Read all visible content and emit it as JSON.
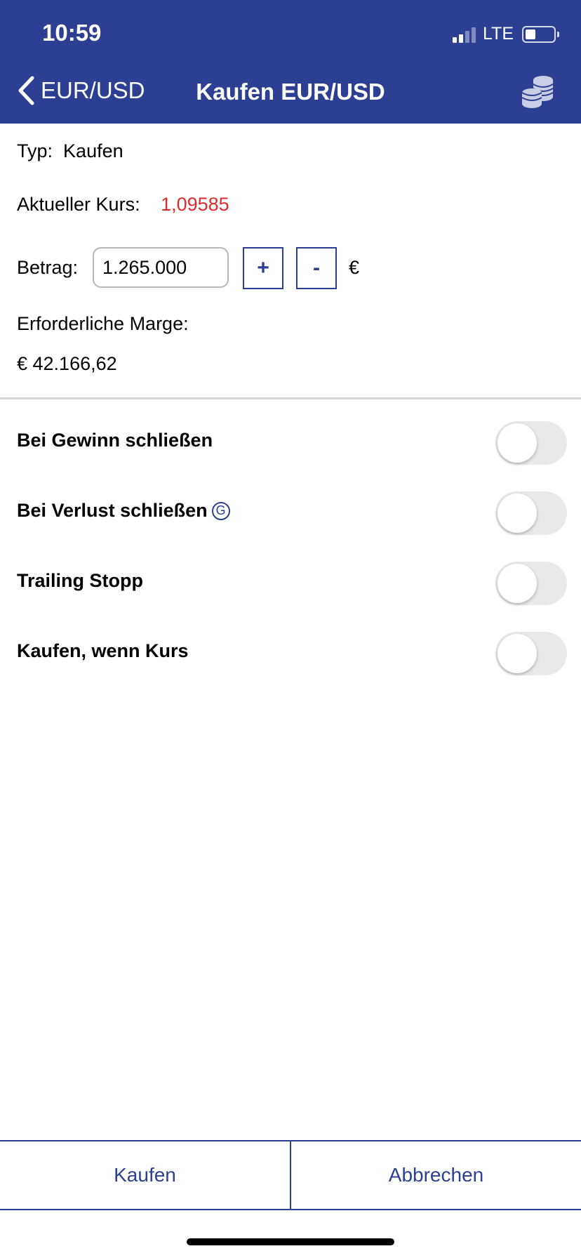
{
  "status_bar": {
    "time": "10:59",
    "network": "LTE"
  },
  "nav": {
    "back_label": "EUR/USD",
    "title": "Kaufen EUR/USD",
    "right_icon": "coins-stack-icon"
  },
  "form": {
    "type_label": "Typ:",
    "type_value": "Kaufen",
    "rate_label": "Aktueller Kurs:",
    "rate_value": "1,09585",
    "amount_label": "Betrag:",
    "amount_value": "1.265.000",
    "increment_label": "+",
    "decrement_label": "-",
    "currency_symbol": "€",
    "margin_label": "Erforderliche Marge:",
    "margin_value": "€ 42.166,62"
  },
  "options": [
    {
      "label": "Bei Gewinn schließen",
      "enabled": false
    },
    {
      "label": "Bei Verlust schließen",
      "enabled": false,
      "info_icon": "G"
    },
    {
      "label": "Trailing Stopp",
      "enabled": false
    },
    {
      "label": "Kaufen, wenn Kurs",
      "enabled": false
    }
  ],
  "actions": {
    "confirm_label": "Kaufen",
    "cancel_label": "Abbrechen"
  },
  "colors": {
    "brand": "#2d3f92",
    "rate": "#e02b2b",
    "toggle_off": "#e9e9eb"
  }
}
